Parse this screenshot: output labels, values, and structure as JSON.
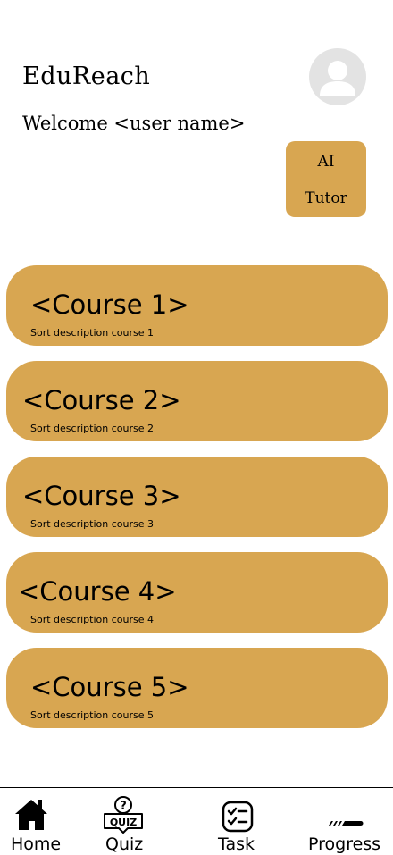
{
  "header": {
    "app_title": "EduReach",
    "welcome_text": "Welcome <user name>",
    "avatar_icon": "user-avatar-icon"
  },
  "ai_tutor": {
    "line1": "AI",
    "line2": "Tutor"
  },
  "colors": {
    "card": "#d8a651",
    "avatar_bg": "#e3e3e3",
    "avatar_fg": "#ffffff"
  },
  "courses": [
    {
      "title": "<Course 1>",
      "description": "Sort description course 1"
    },
    {
      "title": "<Course 2>",
      "description": "Sort description course 2"
    },
    {
      "title": "<Course 3>",
      "description": "Sort description course 3"
    },
    {
      "title": "<Course 4>",
      "description": "Sort description course 4"
    },
    {
      "title": "<Course 5>",
      "description": "Sort description course 5"
    }
  ],
  "nav": {
    "home": {
      "label": "Home",
      "icon": "home-icon"
    },
    "quiz": {
      "label": "Quiz",
      "icon": "quiz-icon",
      "icon_text": "QUIZ"
    },
    "task": {
      "label": "Task",
      "icon": "task-list-icon"
    },
    "progress": {
      "label": "Progress",
      "icon": "progress-bar-icon"
    }
  }
}
